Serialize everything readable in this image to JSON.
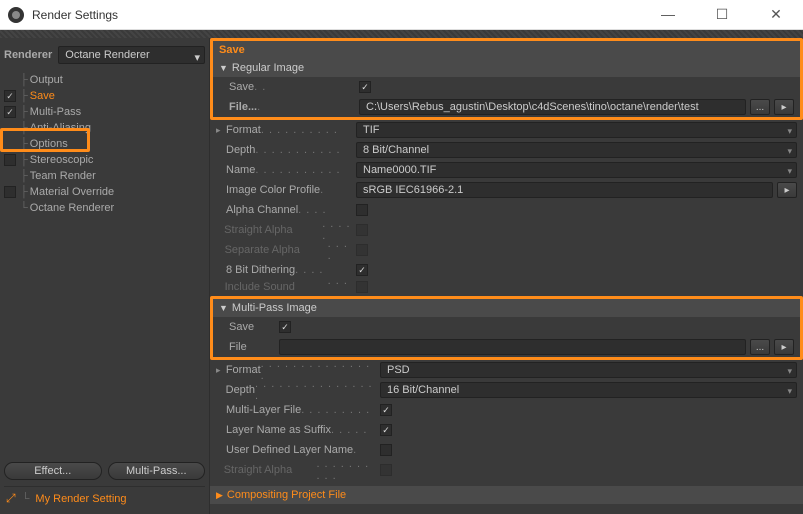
{
  "window": {
    "title": "Render Settings"
  },
  "winbtns": {
    "min": "—",
    "max": "☐",
    "close": "✕"
  },
  "sidebar": {
    "renderer_label": "Renderer",
    "renderer_value": "Octane Renderer",
    "items": [
      {
        "label": "Output",
        "checked": null
      },
      {
        "label": "Save",
        "checked": true,
        "selected": true
      },
      {
        "label": "Multi-Pass",
        "checked": true
      },
      {
        "label": "Anti-Aliasing",
        "checked": null
      },
      {
        "label": "Options",
        "checked": null
      },
      {
        "label": "Stereoscopic",
        "checked": false
      },
      {
        "label": "Team Render",
        "checked": null
      },
      {
        "label": "Material Override",
        "checked": false
      },
      {
        "label": "Octane Renderer",
        "checked": null
      }
    ],
    "effect_btn": "Effect...",
    "multipass_btn": "Multi-Pass...",
    "setting_name": "My Render Setting"
  },
  "main": {
    "tab_title": "Save",
    "regular": {
      "header": "Regular Image",
      "save_label": "Save",
      "save_checked": true,
      "file_label": "File...",
      "file_value": "C:\\Users\\Rebus_agustin\\Desktop\\c4dScenes\\tino\\octane\\render\\test",
      "format_label": "Format",
      "format_value": "TIF",
      "depth_label": "Depth",
      "depth_value": "8 Bit/Channel",
      "name_label": "Name",
      "name_value": "Name0000.TIF",
      "icp_label": "Image Color Profile",
      "icp_value": "sRGB IEC61966-2.1",
      "alpha_label": "Alpha Channel",
      "straight_label": "Straight Alpha",
      "separate_label": "Separate Alpha",
      "dither_label": "8 Bit Dithering",
      "sound_label": "Include Sound"
    },
    "multipass": {
      "header": "Multi-Pass Image",
      "save_label": "Save",
      "file_label": "File",
      "file_value": "",
      "format_label": "Format",
      "format_value": "PSD",
      "depth_label": "Depth",
      "depth_value": "16 Bit/Channel",
      "mlf_label": "Multi-Layer File",
      "lns_label": "Layer Name as Suffix",
      "udln_label": "User Defined Layer Name",
      "straight_label": "Straight Alpha"
    },
    "compositing_header": "Compositing Project File"
  }
}
